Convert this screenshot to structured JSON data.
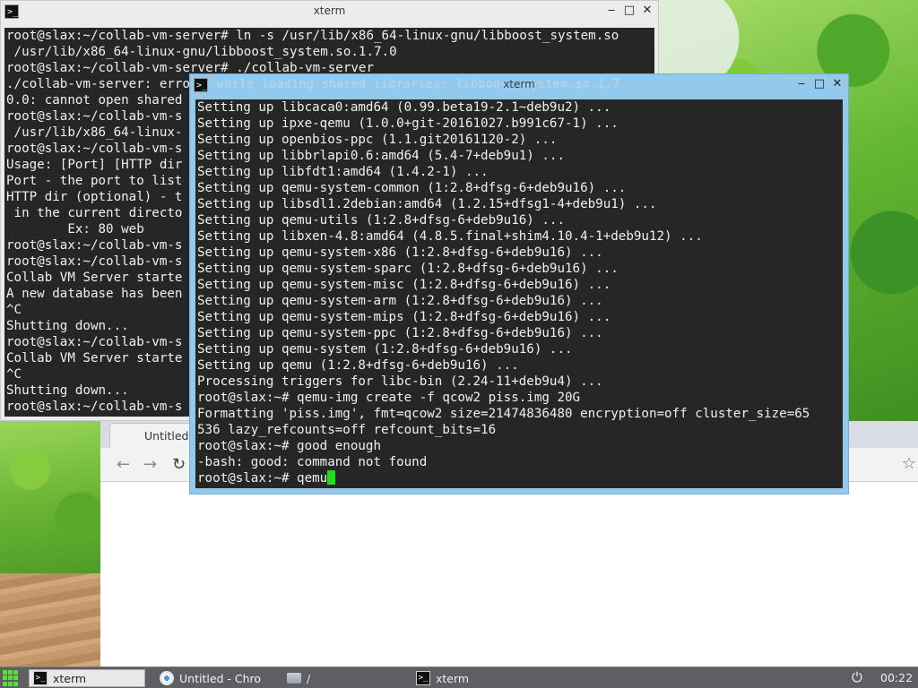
{
  "back_window": {
    "title": "xterm",
    "icon": "terminal-icon",
    "lines": [
      "root@slax:~/collab-vm-server# ln -s /usr/lib/x86_64-linux-gnu/libboost_system.so",
      " /usr/lib/x86_64-linux-gnu/libboost_system.so.1.7.0",
      "root@slax:~/collab-vm-server# ./collab-vm-server",
      "./collab-vm-server: error while loading shared libraries: libboost_system.so.1.7",
      "0.0: cannot open shared",
      "root@slax:~/collab-vm-s",
      " /usr/lib/x86_64-linux-",
      "root@slax:~/collab-vm-s",
      "Usage: [Port] [HTTP dir",
      "Port - the port to list",
      "HTTP dir (optional) - t",
      " in the current directo",
      "        Ex: 80 web",
      "root@slax:~/collab-vm-s",
      "root@slax:~/collab-vm-s",
      "Collab VM Server starte",
      "A new database has been",
      "^C",
      "Shutting down...",
      "root@slax:~/collab-vm-s",
      "Collab VM Server starte",
      "^C",
      "Shutting down...",
      "root@slax:~/collab-vm-s"
    ]
  },
  "front_window": {
    "title": "xterm",
    "icon": "terminal-icon",
    "ghost_text": "while loading shared libraries: libboost_system.so.1.7",
    "lines": [
      "Setting up libcaca0:amd64 (0.99.beta19-2.1~deb9u2) ...",
      "Setting up ipxe-qemu (1.0.0+git-20161027.b991c67-1) ...",
      "Setting up openbios-ppc (1.1.git20161120-2) ...",
      "Setting up libbrlapi0.6:amd64 (5.4-7+deb9u1) ...",
      "Setting up libfdt1:amd64 (1.4.2-1) ...",
      "Setting up qemu-system-common (1:2.8+dfsg-6+deb9u16) ...",
      "Setting up libsdl1.2debian:amd64 (1.2.15+dfsg1-4+deb9u1) ...",
      "Setting up qemu-utils (1:2.8+dfsg-6+deb9u16) ...",
      "Setting up libxen-4.8:amd64 (4.8.5.final+shim4.10.4-1+deb9u12) ...",
      "Setting up qemu-system-x86 (1:2.8+dfsg-6+deb9u16) ...",
      "Setting up qemu-system-sparc (1:2.8+dfsg-6+deb9u16) ...",
      "Setting up qemu-system-misc (1:2.8+dfsg-6+deb9u16) ...",
      "Setting up qemu-system-arm (1:2.8+dfsg-6+deb9u16) ...",
      "Setting up qemu-system-mips (1:2.8+dfsg-6+deb9u16) ...",
      "Setting up qemu-system-ppc (1:2.8+dfsg-6+deb9u16) ...",
      "Setting up qemu-system (1:2.8+dfsg-6+deb9u16) ...",
      "Setting up qemu (1:2.8+dfsg-6+deb9u16) ...",
      "Processing triggers for libc-bin (2.24-11+deb9u4) ...",
      "root@slax:~# qemu-img create -f qcow2 piss.img 20G",
      "Formatting 'piss.img', fmt=qcow2 size=21474836480 encryption=off cluster_size=65",
      "536 lazy_refcounts=off refcount_bits=16",
      "root@slax:~# good enough",
      "-bash: good: command not found"
    ],
    "prompt_line": "root@slax:~# qemu",
    "cursor_color": "#20dc20"
  },
  "window_buttons": {
    "minimize": "‒",
    "maximize": "□",
    "close": "✕"
  },
  "chrome": {
    "tab_title": "Untitled",
    "back_icon": "back-arrow-icon",
    "forward_icon": "forward-arrow-icon",
    "reload_icon": "reload-icon",
    "star_icon": "star-icon"
  },
  "taskbar": {
    "items": [
      {
        "label": "xterm",
        "icon": "terminal-icon",
        "active": true
      },
      {
        "label": "Untitled - Chro",
        "icon": "chrome-icon",
        "active": false
      },
      {
        "label": "/",
        "icon": "folder-icon",
        "active": false
      },
      {
        "label": "xterm",
        "icon": "terminal-icon",
        "active": false
      }
    ],
    "power_icon": "power-icon",
    "clock": "00:22"
  },
  "colors": {
    "terminal_bg": "#262626",
    "terminal_fg": "#f0f0f0",
    "active_frame": "#95c9ec",
    "taskbar_bg": "#5d5f62",
    "start_green": "#5edc3a"
  }
}
